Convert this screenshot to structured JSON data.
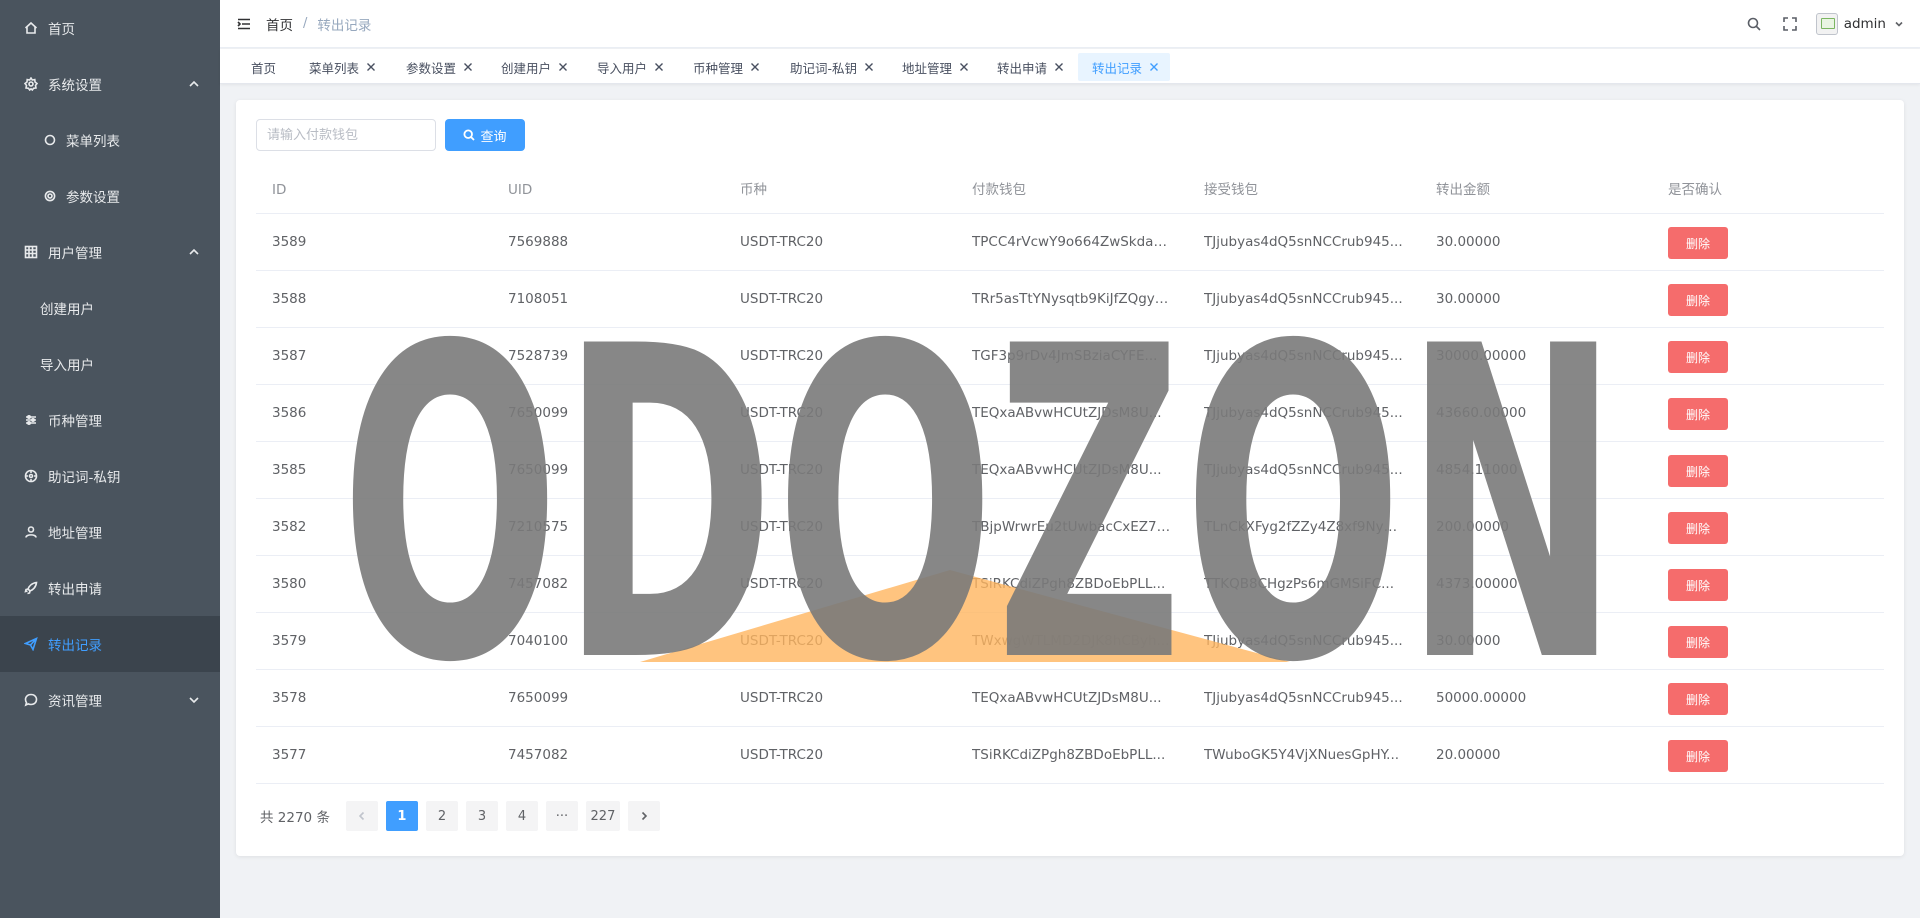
{
  "sidebar": {
    "items": [
      {
        "label": "首页",
        "icon": "home-icon"
      },
      {
        "label": "系统设置",
        "icon": "gear-icon"
      },
      {
        "label": "菜单列表",
        "icon": "circle-icon"
      },
      {
        "label": "参数设置",
        "icon": "settings-icon"
      },
      {
        "label": "用户管理",
        "icon": "grid-icon"
      },
      {
        "label": "创建用户"
      },
      {
        "label": "导入用户"
      },
      {
        "label": "币种管理",
        "icon": "sliders-icon"
      },
      {
        "label": "助记词-私钥",
        "icon": "dial-icon"
      },
      {
        "label": "地址管理",
        "icon": "user-icon"
      },
      {
        "label": "转出申请",
        "icon": "rocket-icon"
      },
      {
        "label": "转出记录",
        "icon": "send-icon"
      },
      {
        "label": "资讯管理",
        "icon": "chat-icon"
      }
    ]
  },
  "header": {
    "breadcrumb_home": "首页",
    "breadcrumb_sep": "/",
    "breadcrumb_current": "转出记录",
    "username": "admin"
  },
  "tabs": [
    {
      "label": "首页"
    },
    {
      "label": "菜单列表"
    },
    {
      "label": "参数设置"
    },
    {
      "label": "创建用户"
    },
    {
      "label": "导入用户"
    },
    {
      "label": "币种管理"
    },
    {
      "label": "助记词-私钥"
    },
    {
      "label": "地址管理"
    },
    {
      "label": "转出申请"
    },
    {
      "label": "转出记录"
    }
  ],
  "search": {
    "placeholder": "请输入付款钱包",
    "button_label": "查询"
  },
  "table": {
    "columns": [
      "ID",
      "UID",
      "币种",
      "付款钱包",
      "接受钱包",
      "转出金额",
      "是否确认"
    ],
    "delete_label": "删除",
    "rows": [
      {
        "id": "3589",
        "uid": "7569888",
        "coin": "USDT-TRC20",
        "from": "TPCC4rVcwY9o664ZwSkdax...",
        "to": "TJjubyas4dQ5snNCCrub945...",
        "amount": "30.00000"
      },
      {
        "id": "3588",
        "uid": "7108051",
        "coin": "USDT-TRC20",
        "from": "TRr5asTtYNysqtb9KiJfZQgyz...",
        "to": "TJjubyas4dQ5snNCCrub945...",
        "amount": "30.00000"
      },
      {
        "id": "3587",
        "uid": "7528739",
        "coin": "USDT-TRC20",
        "from": "TGF3p9rDv4JmSBziaCYFE...",
        "to": "TJjubyas4dQ5snNCCrub945...",
        "amount": "30000.00000"
      },
      {
        "id": "3586",
        "uid": "7650099",
        "coin": "USDT-TRC20",
        "from": "TEQxaABvwHCUtZJDsM8U...",
        "to": "TJjubyas4dQ5snNCCrub945...",
        "amount": "43660.00000"
      },
      {
        "id": "3585",
        "uid": "7650099",
        "coin": "USDT-TRC20",
        "from": "TEQxaABvwHCUtZJDsM8U...",
        "to": "TJjubyas4dQ5snNCCrub945...",
        "amount": "4854.11000"
      },
      {
        "id": "3582",
        "uid": "7210575",
        "coin": "USDT-TRC20",
        "from": "TBjpWrwrEu2tUwbacCxEZ7h...",
        "to": "TLnCkXFyg2fZZy4Z8xf9Ny1...",
        "amount": "200.00000"
      },
      {
        "id": "3580",
        "uid": "7457082",
        "coin": "USDT-TRC20",
        "from": "TSiRKCdiZPgh8ZBDoEbPLL...",
        "to": "TTKQB8CHgzPs6mGMSiFC...",
        "amount": "4373.00000"
      },
      {
        "id": "3579",
        "uid": "7040100",
        "coin": "USDT-TRC20",
        "from": "TWxwgWTLMD2DJK8hCByh...",
        "to": "TJjubyas4dQ5snNCCrub945...",
        "amount": "30.00000"
      },
      {
        "id": "3578",
        "uid": "7650099",
        "coin": "USDT-TRC20",
        "from": "TEQxaABvwHCUtZJDsM8U...",
        "to": "TJjubyas4dQ5snNCCrub945...",
        "amount": "50000.00000"
      },
      {
        "id": "3577",
        "uid": "7457082",
        "coin": "USDT-TRC20",
        "from": "TSiRKCdiZPgh8ZBDoEbPLL...",
        "to": "TWuboGK5Y4VjXNuesGpHY...",
        "amount": "20.00000"
      }
    ]
  },
  "pagination": {
    "total_text": "共 2270 条",
    "pages": [
      "1",
      "2",
      "3",
      "4",
      "···",
      "227"
    ],
    "current": "1"
  },
  "watermark": {
    "text": "ODOZON",
    "text_color": "#7a7a7a",
    "accent_color": "#ffb55f"
  },
  "colors": {
    "primary": "#409eff",
    "danger": "#f56c6c",
    "sidebar_bg": "#4a545e",
    "sidebar_active_bg": "#3b444d"
  }
}
